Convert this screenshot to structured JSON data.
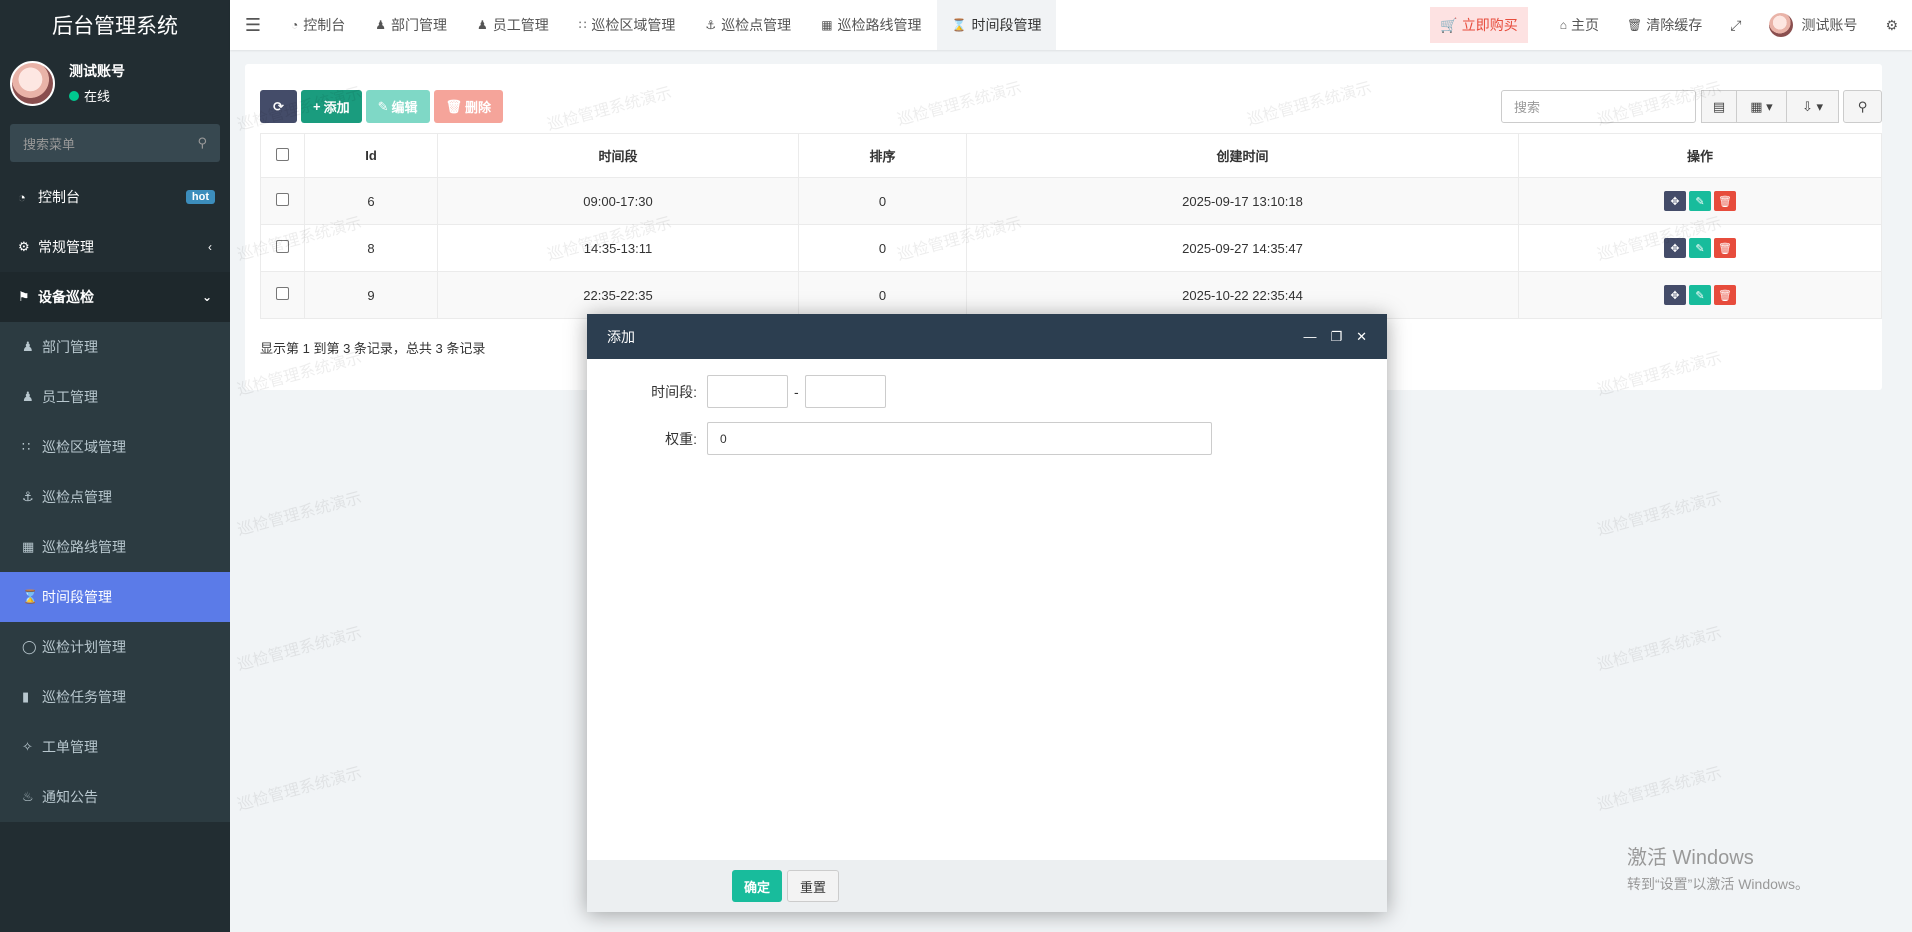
{
  "app": {
    "title": "后台管理系统"
  },
  "user": {
    "name": "测试账号",
    "status": "在线"
  },
  "sidebar": {
    "search_placeholder": "搜索菜单",
    "items": [
      {
        "label": "控制台",
        "badge": "hot"
      },
      {
        "label": "常规管理"
      },
      {
        "label": "设备巡检"
      }
    ],
    "sub_items": [
      {
        "label": "部门管理"
      },
      {
        "label": "员工管理"
      },
      {
        "label": "巡检区域管理"
      },
      {
        "label": "巡检点管理"
      },
      {
        "label": "巡检路线管理"
      },
      {
        "label": "时间段管理"
      },
      {
        "label": "巡检计划管理"
      },
      {
        "label": "巡检任务管理"
      },
      {
        "label": "工单管理"
      },
      {
        "label": "通知公告"
      }
    ]
  },
  "topnav": {
    "tabs": [
      {
        "label": "控制台"
      },
      {
        "label": "部门管理"
      },
      {
        "label": "员工管理"
      },
      {
        "label": "巡检区域管理"
      },
      {
        "label": "巡检点管理"
      },
      {
        "label": "巡检路线管理"
      },
      {
        "label": "时间段管理"
      }
    ],
    "buy": "立即购买",
    "home": "主页",
    "clear_cache": "清除缓存",
    "user": "测试账号"
  },
  "toolbar": {
    "add": "添加",
    "edit": "编辑",
    "delete": "删除",
    "search_placeholder": "搜索"
  },
  "table": {
    "columns": [
      "Id",
      "时间段",
      "排序",
      "创建时间",
      "操作"
    ],
    "rows": [
      {
        "id": "6",
        "period": "09:00-17:30",
        "sort": "0",
        "created": "2025-09-17 13:10:18"
      },
      {
        "id": "8",
        "period": "14:35-13:11",
        "sort": "0",
        "created": "2025-09-27 14:35:47"
      },
      {
        "id": "9",
        "period": "22:35-22:35",
        "sort": "0",
        "created": "2025-10-22 22:35:44"
      }
    ],
    "summary": "显示第 1 到第 3 条记录，总共 3 条记录"
  },
  "modal": {
    "title": "添加",
    "period_label": "时间段:",
    "period_sep": "-",
    "weight_label": "权重:",
    "weight_value": "0",
    "ok": "确定",
    "reset": "重置"
  },
  "watermark": "巡检管理系统演示",
  "windows": {
    "line1": "激活 Windows",
    "line2": "转到“设置”以激活 Windows。"
  },
  "colors": {
    "sidebar": "#222d32",
    "active_menu": "#5b7be8",
    "accent": "#18bc9c",
    "danger": "#e74c3c",
    "modal_header": "#2c3e50"
  }
}
